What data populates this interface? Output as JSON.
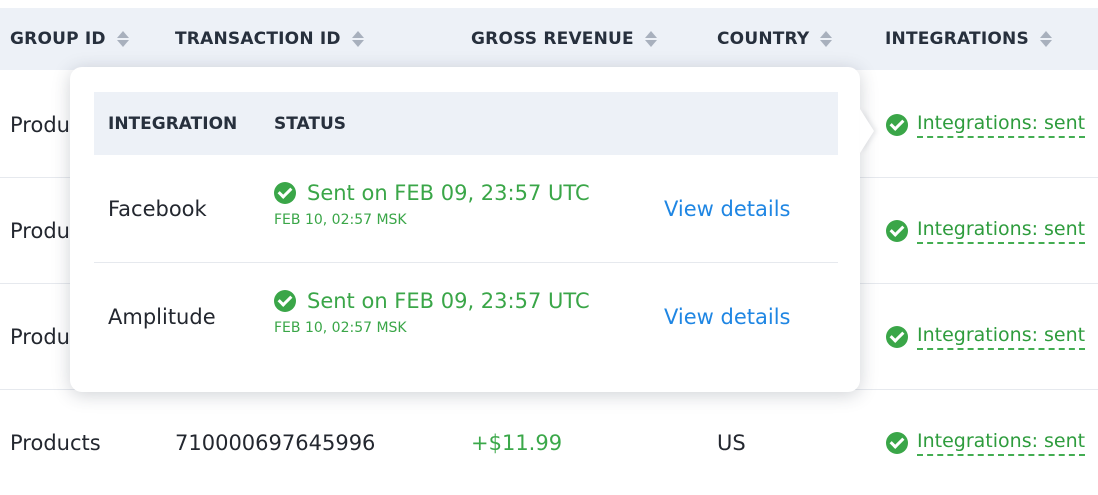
{
  "table": {
    "columns": [
      {
        "label": "GROUP ID"
      },
      {
        "label": "TRANSACTION ID"
      },
      {
        "label": "GROSS REVENUE"
      },
      {
        "label": "COUNTRY"
      },
      {
        "label": "INTEGRATIONS"
      }
    ],
    "rows": [
      {
        "group": "Produ",
        "integrations": "Integrations: sent"
      },
      {
        "group": "Produ",
        "integrations": "Integrations: sent"
      },
      {
        "group": "Produ",
        "integrations": "Integrations: sent"
      },
      {
        "group": "Products",
        "transaction_id": "710000697645996",
        "revenue": "+$11.99",
        "country": "US",
        "integrations": "Integrations: sent"
      }
    ]
  },
  "popover": {
    "headers": {
      "integration": "INTEGRATION",
      "status": "STATUS"
    },
    "rows": [
      {
        "name": "Facebook",
        "status": "Sent on FEB 09, 23:57 UTC",
        "local_time": "FEB 10, 02:57 MSK",
        "action": "View details"
      },
      {
        "name": "Amplitude",
        "status": "Sent on FEB 09, 23:57 UTC",
        "local_time": "FEB 10, 02:57 MSK",
        "action": "View details"
      }
    ]
  },
  "colors": {
    "accent_green": "#3aa648",
    "link_blue": "#1f86e3",
    "header_bg": "#edf1f7"
  },
  "icons": {
    "status_sent": "check-circle-icon",
    "sort": "sort-arrows-icon"
  }
}
